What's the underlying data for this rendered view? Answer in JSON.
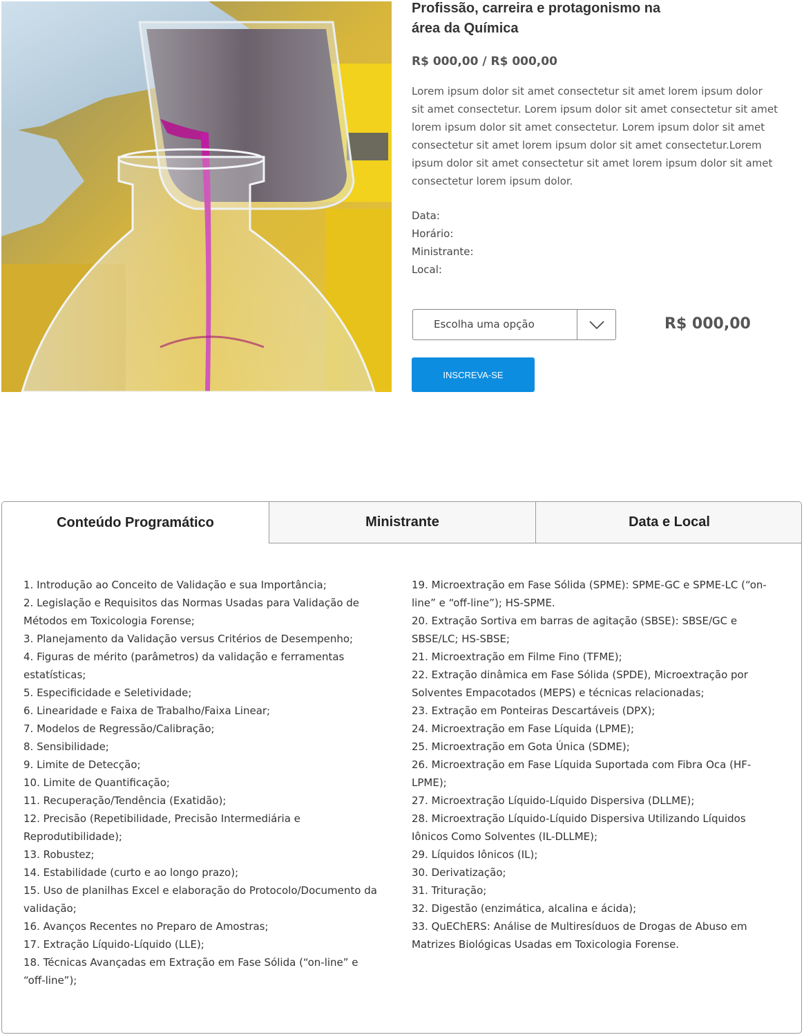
{
  "product": {
    "title": "Profissão, carreira e protagonismo na área da Química",
    "price_range": "R$ 000,00 / R$ 000,00",
    "description": "Lorem ipsum dolor sit amet consectetur sit amet lorem ipsum dolor sit amet consectetur. Lorem ipsum dolor sit amet consectetur sit amet lorem ipsum dolor sit amet consectetur. Lorem ipsum dolor sit amet consectetur sit amet lorem ipsum dolor sit amet consectetur.Lorem ipsum dolor sit amet consectetur sit amet lorem ipsum dolor sit amet consectetur  lorem ipsum dolor.",
    "meta": {
      "date_label": "Data:",
      "time_label": "Horário:",
      "instructor_label": "Ministrante:",
      "location_label": "Local:"
    },
    "select_placeholder": "Escolha uma opção",
    "price": "R$ 000,00",
    "button_label": "INSCREVA-SE",
    "accent_color": "#0d8de0"
  },
  "tabs": [
    {
      "label": "Conteúdo Programático",
      "active": true
    },
    {
      "label": "Ministrante",
      "active": false
    },
    {
      "label": "Data e Local",
      "active": false
    }
  ],
  "content": {
    "left": [
      "1. Introdução ao Conceito de Validação e sua Importância;",
      "2. Legislação e Requisitos das Normas Usadas para Validação de Métodos em Toxicologia Forense;",
      "3. Planejamento da Validação versus Critérios de Desempenho;",
      "4. Figuras de mérito (parâmetros) da validação e ferramentas estatísticas;",
      "5. Especificidade e Seletividade;",
      "6. Linearidade e Faixa de Trabalho/Faixa Linear;",
      "7. Modelos de Regressão/Calibração;",
      "8. Sensibilidade;",
      "9. Limite de Detecção;",
      "10. Limite de Quantificação;",
      "11. Recuperação/Tendência (Exatidão);",
      "12. Precisão (Repetibilidade, Precisão Intermediária e Reprodutibilidade);",
      "13. Robustez;",
      "14. Estabilidade (curto e ao longo prazo);",
      "15. Uso de planilhas Excel e elaboração do Protocolo/Documento da validação;",
      "16. Avanços Recentes no Preparo de Amostras;",
      "17. Extração Líquido-Líquido (LLE);",
      "18. Técnicas Avançadas em Extração em Fase Sólida (“on-line” e “off-line”);"
    ],
    "right": [
      "19. Microextração em Fase Sólida (SPME): SPME-GC e SPME-LC (“on-line” e “off-line”); HS-SPME.",
      "20. Extração Sortiva em barras de agitação (SBSE): SBSE/GC e SBSE/LC; HS-SBSE;",
      "21. Microextração em Filme Fino (TFME);",
      "22. Extração dinâmica em Fase Sólida (SPDE), Microextração por Solventes Empacotados (MEPS) e técnicas relacionadas;",
      "23. Extração em Ponteiras Descartáveis (DPX);",
      "24. Microextração em Fase Líquida (LPME);",
      "25. Microextração em Gota Única (SDME);",
      "26. Microextração em Fase Líquida Suportada com Fibra Oca (HF-LPME);",
      "27. Microextração Líquido-Líquido Dispersiva (DLLME);",
      "28. Microextração Líquido-Líquido Dispersiva Utilizando Líquidos Iônicos Como Solventes (IL-DLLME);",
      "29. Líquidos Iônicos (IL);",
      "30. Derivatização;",
      "31. Trituração;",
      "32. Digestão (enzimática, alcalina e ácida);",
      "33. QuEChERS: Análise de Multiresíduos de Drogas de Abuso em Matrizes Biológicas Usadas em Toxicologia Forense."
    ]
  }
}
